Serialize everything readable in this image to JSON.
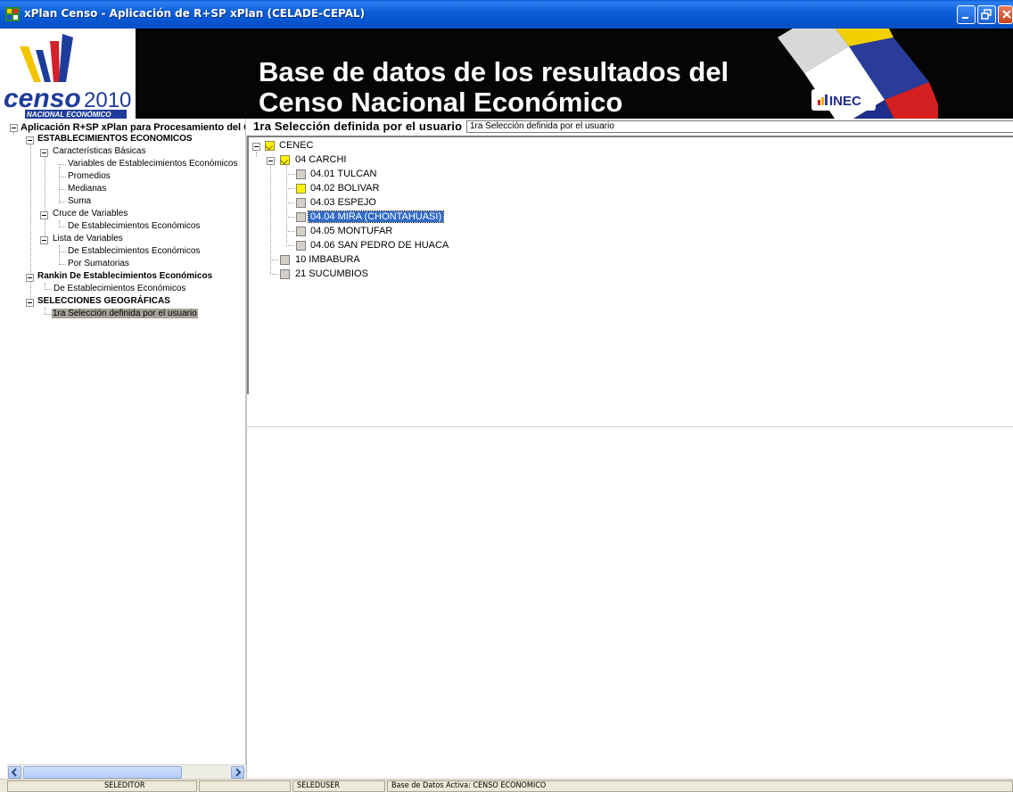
{
  "window": {
    "title": "xPlan Censo - Aplicación de R+SP xPlan (CELADE-CEPAL)",
    "app_icon": "xplan-app-icon"
  },
  "banner": {
    "logo_word": "censo",
    "logo_year": "2010",
    "logo_sub": "NACIONAL ECONÓMICO",
    "heading_line1": "Base de datos de los resultados del",
    "heading_line2": "Censo Nacional Económico",
    "inec_logo": "INEC"
  },
  "nav_tree": {
    "root": "Aplicación R+SP xPlan para Procesamiento del Cl",
    "items": [
      {
        "label": "ESTABLECIMIENTOS ECONOMICOS"
      },
      {
        "label": "Características Básicas"
      },
      {
        "label": "Variables de Establecimientos Económicos"
      },
      {
        "label": "Promedios"
      },
      {
        "label": "Medianas"
      },
      {
        "label": "Suma"
      },
      {
        "label": "Cruce de Variables"
      },
      {
        "label": "De Establecimientos Económicos"
      },
      {
        "label": "Lista de Variables"
      },
      {
        "label": "De Establecimientos Económicos"
      },
      {
        "label": "Por Sumatorias"
      },
      {
        "label": "Rankin De Establecimientos Económicos"
      },
      {
        "label": "De Establecimientos Económicos"
      },
      {
        "label": "SELECCIONES GEOGRÁFICAS"
      },
      {
        "label": "1ra Selección definida por el usuario"
      }
    ]
  },
  "selection": {
    "label": "1ra Selección definida por el usuario",
    "name_value": "1ra Selección definida por el usuario"
  },
  "geo_tree": {
    "items": [
      {
        "label": "CENEC",
        "state": "partial"
      },
      {
        "label": "04 CARCHI",
        "state": "partial"
      },
      {
        "label": "04.01 TULCAN",
        "state": "unchecked"
      },
      {
        "label": "04.02 BOLIVAR",
        "state": "checked"
      },
      {
        "label": "04.03 ESPEJO",
        "state": "unchecked"
      },
      {
        "label": "04.04 MIRA (CHONTAHUASI)",
        "state": "unchecked"
      },
      {
        "label": "04.05 MONTUFAR",
        "state": "unchecked"
      },
      {
        "label": "04.06 SAN PEDRO DE HUACA",
        "state": "unchecked"
      },
      {
        "label": "10 IMBABURA",
        "state": "unchecked"
      },
      {
        "label": "21 SUCUMBIOS",
        "state": "unchecked"
      }
    ]
  },
  "statusbar": {
    "cell1": "SELEDITOR",
    "cell2": "",
    "cell3": "SELEDUSER",
    "cell4": "Base de Datos Activa: CENSO ECONOMICO"
  },
  "colors": {
    "titlebar": "#0a5ed8",
    "selection_highlight": "#316ac5",
    "nav_selected": "#a8a39a",
    "checked_yellow": "#fff200"
  }
}
